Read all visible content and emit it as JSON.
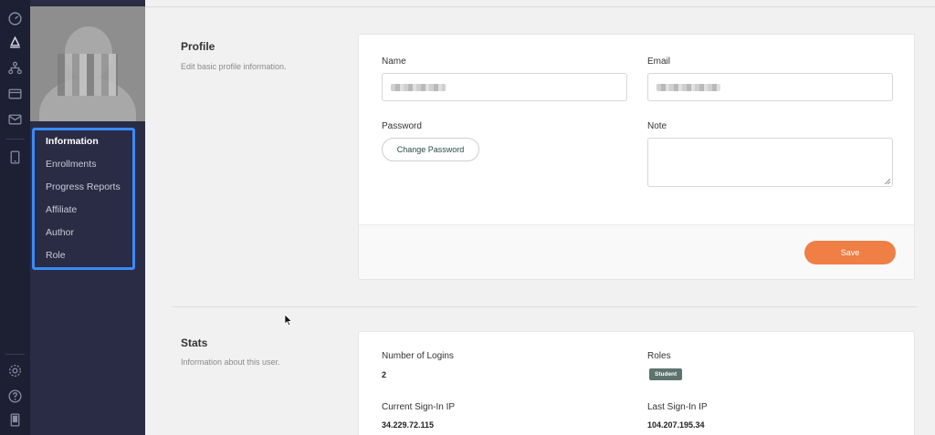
{
  "rail": {
    "icons": [
      "dashboard-icon",
      "courses-icon",
      "sitemap-icon",
      "billing-icon",
      "mail-icon",
      "tablet-icon",
      "settings-icon",
      "help-icon",
      "device-icon"
    ]
  },
  "user_menu": {
    "items": [
      {
        "label": "Information",
        "active": true
      },
      {
        "label": "Enrollments",
        "active": false
      },
      {
        "label": "Progress Reports",
        "active": false
      },
      {
        "label": "Affiliate",
        "active": false
      },
      {
        "label": "Author",
        "active": false
      },
      {
        "label": "Role",
        "active": false
      }
    ]
  },
  "profile": {
    "title": "Profile",
    "description": "Edit basic profile information.",
    "name_label": "Name",
    "email_label": "Email",
    "password_label": "Password",
    "change_password_label": "Change Password",
    "note_label": "Note",
    "save_label": "Save"
  },
  "stats": {
    "title": "Stats",
    "description": "Information about this user.",
    "logins_label": "Number of Logins",
    "logins_value": "2",
    "roles_label": "Roles",
    "role_badge": "Student",
    "current_ip_label": "Current Sign-In IP",
    "current_ip_value": "34.229.72.115",
    "last_ip_label": "Last Sign-In IP",
    "last_ip_value": "104.207.195.34"
  },
  "colors": {
    "rail_bg": "#1d1f33",
    "panel_bg": "#2a2c46",
    "highlight": "#3a8bf7",
    "save_button": "#ef7f45",
    "badge": "#5d736e"
  }
}
